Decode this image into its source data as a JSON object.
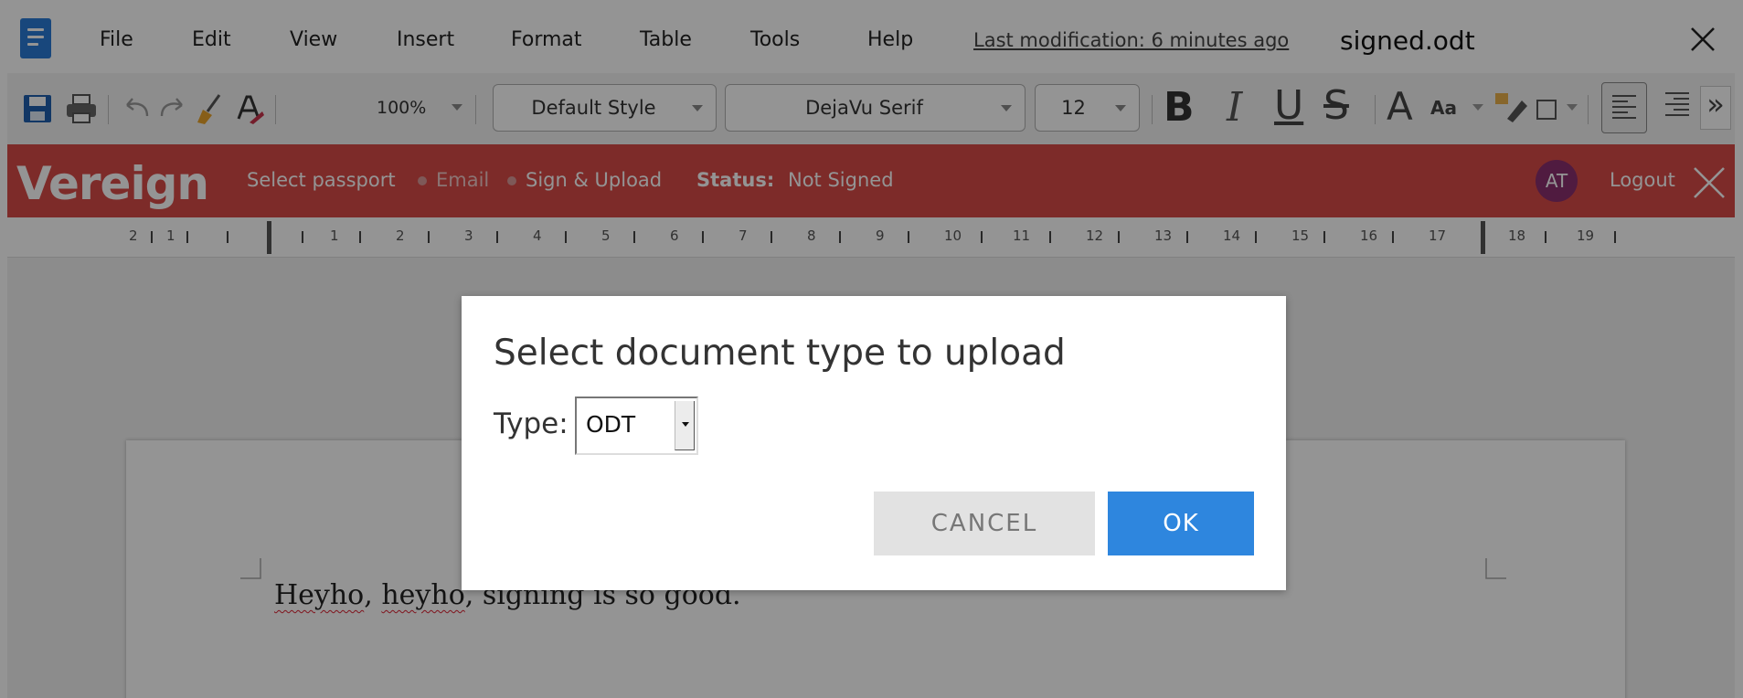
{
  "menubar": {
    "items": [
      "File",
      "Edit",
      "View",
      "Insert",
      "Format",
      "Table",
      "Tools",
      "Help"
    ],
    "last_modification": "Last modification: 6 minutes ago",
    "file_name": "signed.odt"
  },
  "toolbar": {
    "zoom": "100%",
    "paragraph_style": "Default Style",
    "font_name": "DejaVu Serif",
    "font_size": "12",
    "bold_glyph": "B",
    "italic_glyph": "I",
    "underline_glyph": "U",
    "strike_glyph": "S",
    "grow_font_glyph": "A",
    "case_glyph": "Aa",
    "more_glyph": "»"
  },
  "vereign": {
    "logo": "Vereign",
    "select_passport": "Select passport",
    "email": "Email",
    "sign_upload": "Sign & Upload",
    "status_label": "Status:",
    "status_value": "Not Signed",
    "avatar_initials": "AT",
    "logout": "Logout",
    "colors": {
      "bar": "#d84a48",
      "avatar": "#8a2f6e"
    }
  },
  "ruler": {
    "labels": [
      "2",
      "1",
      "1",
      "2",
      "3",
      "4",
      "5",
      "6",
      "7",
      "8",
      "9",
      "10",
      "11",
      "12",
      "13",
      "14",
      "15",
      "16",
      "17",
      "18",
      "19"
    ]
  },
  "document": {
    "words": {
      "w1": "Heyho",
      "w2": ",",
      "w3": "heyho",
      "w4": ", signing is so good."
    }
  },
  "dialog": {
    "title": "Select document type to upload",
    "type_label": "Type:",
    "type_value": "ODT",
    "cancel_label": "CANCEL",
    "ok_label": "OK",
    "colors": {
      "ok": "#2e86de",
      "cancel": "#e2e2e2"
    }
  }
}
